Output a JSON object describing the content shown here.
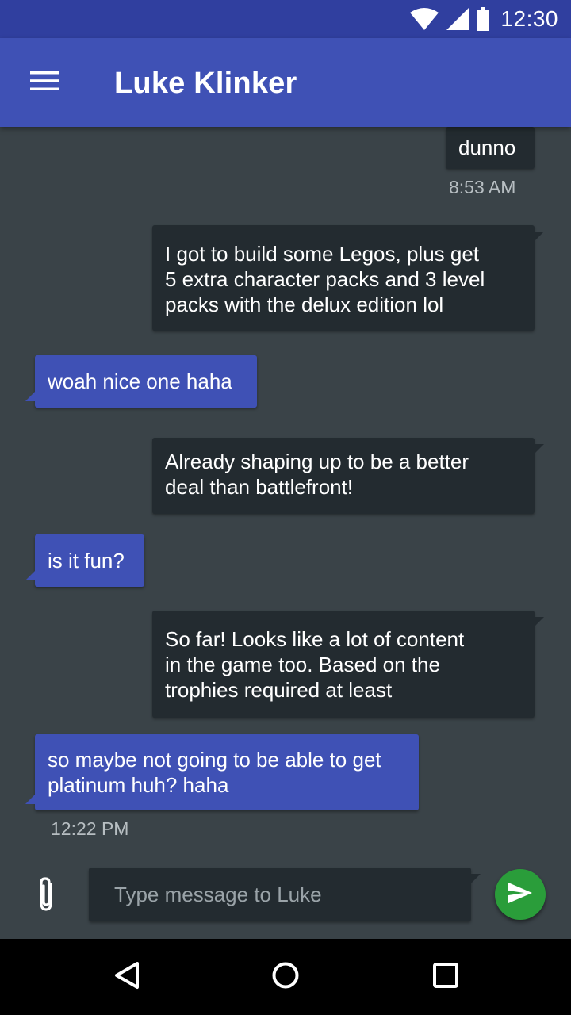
{
  "status_bar": {
    "time": "12:30",
    "icons": [
      "wifi-icon",
      "cell-signal-icon",
      "battery-icon"
    ]
  },
  "app_bar": {
    "title": "Luke Klinker",
    "menu_icon": "hamburger-menu-icon",
    "color": "#3f51b5"
  },
  "messages": [
    {
      "direction": "sent",
      "text": "dunno"
    },
    {
      "direction": "sent",
      "text": "I got to build some Legos, plus get\n5 extra character packs and 3 level\npacks with the delux edition lol"
    },
    {
      "direction": "received",
      "text": "woah nice one haha"
    },
    {
      "direction": "sent",
      "text": "Already shaping up to be a better\ndeal than battlefront!"
    },
    {
      "direction": "received",
      "text": "is it fun?"
    },
    {
      "direction": "sent",
      "text": "So far! Looks like a lot of content\nin the game too. Based on the\ntrophies required at least"
    },
    {
      "direction": "received",
      "text": "so maybe not going to be able to get\nplatinum huh? haha"
    }
  ],
  "timestamps": [
    "8:53 AM",
    "12:22 PM"
  ],
  "composer": {
    "placeholder": "Type message to Luke",
    "value": "",
    "attach_icon": "paperclip-icon",
    "send_icon": "send-icon",
    "send_color": "#2a9d3a"
  },
  "nav_bar": {
    "buttons": [
      "back-icon",
      "home-icon",
      "recents-icon"
    ]
  },
  "colors": {
    "background": "#3a4348",
    "sent_bubble": "#232b30",
    "received_bubble": "#3f51b5",
    "status_bar": "#303f9f"
  }
}
